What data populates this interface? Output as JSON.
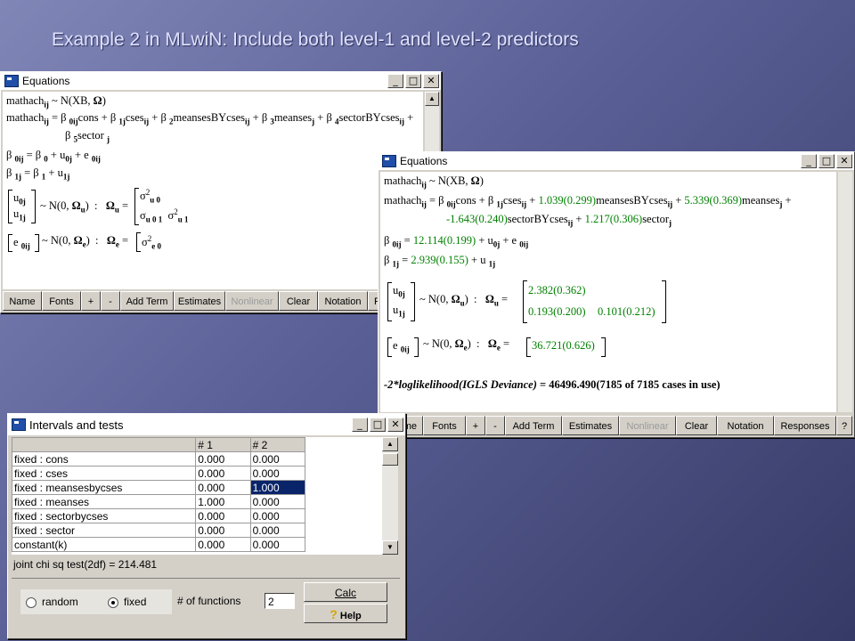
{
  "slide_title": "Example 2 in MLwiN: Include both level-1 and level-2 predictors",
  "win1": {
    "title": "Equations",
    "lines": {
      "l1a": "mathach",
      "l1s": "ij",
      "l1b": "~ N(XB, ",
      "l1c": ")",
      "l2": "mathach",
      "l3": "sector",
      "l4": "β",
      "l5": "β"
    },
    "toolbar": [
      "Name",
      "Fonts",
      "+",
      "-",
      "Add Term",
      "Estimates",
      "Nonlinear",
      "Clear",
      "Notation",
      "R"
    ]
  },
  "win2": {
    "title": "Equations",
    "fixed_coefs": {
      "meansesBYcses": "1.039(0.299)",
      "meanses": "5.339(0.369)",
      "sectorBYcses": "-1.643(0.240)",
      "sector": "1.217(0.306)",
      "b0": "12.114(0.199)",
      "b1": "2.939(0.155)"
    },
    "omega_u": {
      "var_u0": "2.382(0.362)",
      "cov_u01": "0.193(0.200)",
      "var_u1": "0.101(0.212)"
    },
    "omega_e": {
      "var_e0": "36.721(0.626)"
    },
    "deviance": {
      "label": "-2*loglikelihood(IGLS Deviance)",
      "value": "= 46496.490(7185 of 7185 cases in use)"
    },
    "toolbar": [
      "me",
      "Fonts",
      "+",
      "-",
      "Add Term",
      "Estimates",
      "Nonlinear",
      "Clear",
      "Notation",
      "Responses"
    ]
  },
  "intervals": {
    "title": "Intervals and tests",
    "columns": [
      "",
      "# 1",
      "# 2"
    ],
    "rows": [
      {
        "label": "fixed : cons",
        "c1": "0.000",
        "c2": "0.000"
      },
      {
        "label": "fixed : cses",
        "c1": "0.000",
        "c2": "0.000"
      },
      {
        "label": "fixed : meansesbycses",
        "c1": "0.000",
        "c2": "1.000"
      },
      {
        "label": "fixed : meanses",
        "c1": "1.000",
        "c2": "0.000"
      },
      {
        "label": "fixed : sectorbycses",
        "c1": "0.000",
        "c2": "0.000"
      },
      {
        "label": "fixed : sector",
        "c1": "0.000",
        "c2": "0.000"
      },
      {
        "label": "constant(k)",
        "c1": "0.000",
        "c2": "0.000"
      }
    ],
    "result_text": "joint chi sq test(2df) = 214.481",
    "radio_random": "random",
    "radio_fixed": "fixed",
    "functions_label": "# of functions",
    "functions_value": "2",
    "calc_label": "Calc",
    "help_label": "Help"
  }
}
